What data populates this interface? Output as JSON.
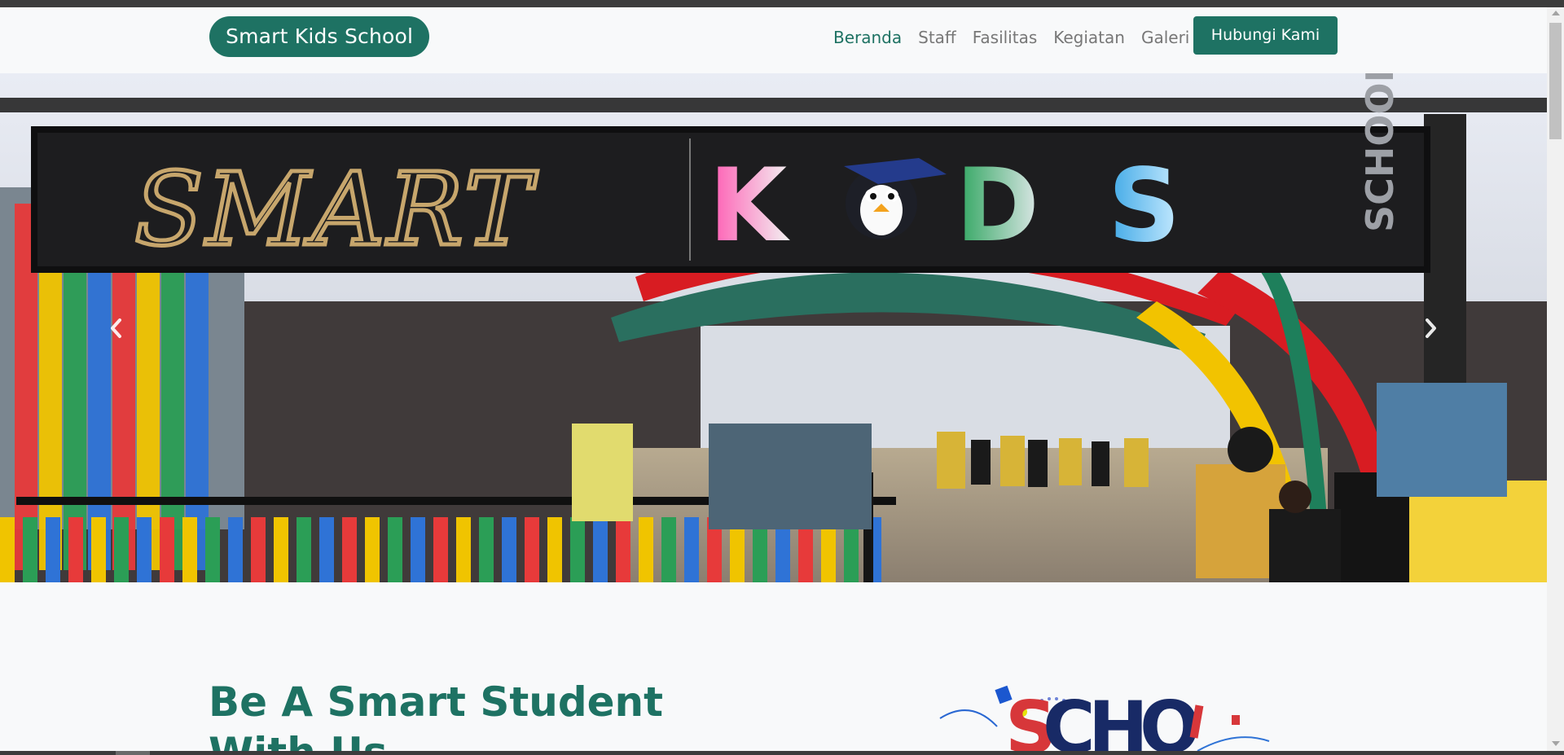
{
  "brand": {
    "name": "Smart Kids School"
  },
  "nav": {
    "items": [
      {
        "label": "Beranda",
        "active": true
      },
      {
        "label": "Staff",
        "active": false
      },
      {
        "label": "Fasilitas",
        "active": false
      },
      {
        "label": "Kegiatan",
        "active": false
      },
      {
        "label": "Galeri",
        "active": false
      }
    ],
    "cta_label": "Hubungi Kami"
  },
  "hero": {
    "sign_text_smart": "SMART",
    "sign_text_kids": "KIDS",
    "sign_text_school": "SCHOOL",
    "prev_icon": "chevron-left-icon",
    "next_icon": "chevron-right-icon"
  },
  "section": {
    "title": "Be A Smart Student With Us"
  },
  "colors": {
    "brand": "#1e7263",
    "nav_text": "#777777",
    "page_bg": "#f8f9fa"
  }
}
